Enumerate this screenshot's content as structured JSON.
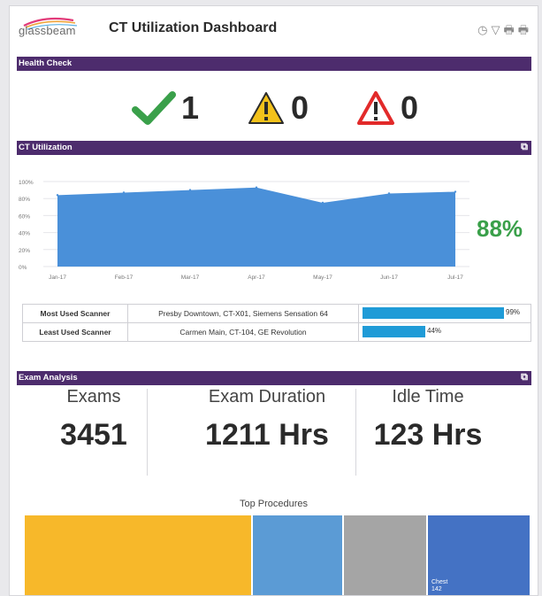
{
  "app": {
    "logo_text": "glassbeam",
    "title": "CT Utilization Dashboard",
    "icons": [
      "clock-icon",
      "filter-icon",
      "print-icon",
      "print-preview-icon"
    ]
  },
  "health_check": {
    "header": "Health Check",
    "items": [
      {
        "icon": "green-check-icon",
        "count": "1",
        "color": "#3aa04a"
      },
      {
        "icon": "yellow-warning-icon",
        "count": "0",
        "color": "#f3c21b"
      },
      {
        "icon": "red-warning-icon",
        "count": "0",
        "color": "#e22a2a"
      }
    ]
  },
  "ct_utilization": {
    "header": "CT Utilization",
    "current_pct": "88%",
    "chart_data": {
      "type": "area",
      "x": [
        "Jan-17",
        "Feb-17",
        "Mar-17",
        "Apr-17",
        "May-17",
        "Jun-17",
        "Jul-17"
      ],
      "y_ticks": [
        "0%",
        "20%",
        "40%",
        "60%",
        "80%",
        "100%"
      ],
      "ylim": [
        0,
        100
      ],
      "series": [
        {
          "values": [
            84,
            87,
            90,
            93,
            75,
            86,
            88
          ],
          "color": "#4a90d9"
        }
      ]
    },
    "scanners": [
      {
        "label": "Most Used Scanner",
        "name": "Presby Downtown, CT-X01, Siemens Sensation 64",
        "pct": "99%",
        "fraction": 0.99
      },
      {
        "label": "Least Used Scanner",
        "name": "Carmen Main, CT-104, GE Revolution",
        "pct": "44%",
        "fraction": 0.44
      }
    ]
  },
  "exam_analysis": {
    "header": "Exam Analysis",
    "kpis": [
      {
        "label": "Exams",
        "value": "3451"
      },
      {
        "label": "Exam Duration",
        "value": "1211 Hrs"
      },
      {
        "label": "Idle Time",
        "value": "123 Hrs"
      }
    ],
    "top_procedures": {
      "title": "Top Procedures",
      "tiles": [
        {
          "label": "",
          "value": "",
          "color": "#f7b82a",
          "share": 0.45
        },
        {
          "label": "",
          "value": "",
          "color": "#5b9bd5",
          "share": 0.18
        },
        {
          "label": "",
          "value": "",
          "color": "#a5a5a5",
          "share": 0.165
        },
        {
          "label": "Chest",
          "value": "142",
          "color": "#4472c4",
          "share": 0.205
        }
      ]
    }
  }
}
